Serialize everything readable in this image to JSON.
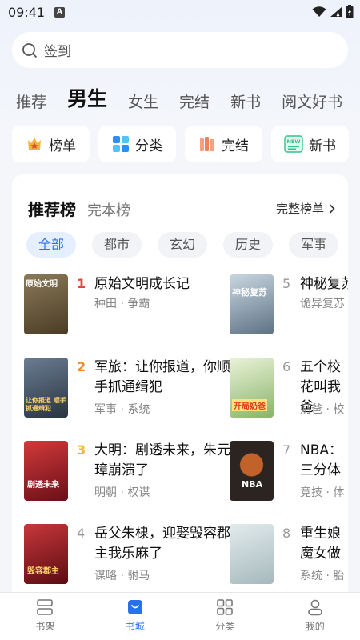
{
  "status_bar": {
    "time": "09:41",
    "badge": "A"
  },
  "search": {
    "placeholder": "签到"
  },
  "channels": [
    {
      "label": "推荐",
      "active": false
    },
    {
      "label": "男生",
      "active": true
    },
    {
      "label": "女生",
      "active": false
    },
    {
      "label": "完结",
      "active": false
    },
    {
      "label": "新书",
      "active": false
    },
    {
      "label": "阅文好书",
      "active": false
    }
  ],
  "quick_links": [
    {
      "label": "榜单",
      "icon": "crown-icon"
    },
    {
      "label": "分类",
      "icon": "grid-icon"
    },
    {
      "label": "完结",
      "icon": "books-icon"
    },
    {
      "label": "新书",
      "icon": "new-icon",
      "icon_text": "NEW"
    }
  ],
  "ranking": {
    "tabs": [
      {
        "label": "推荐榜",
        "active": true
      },
      {
        "label": "完本榜",
        "active": false
      }
    ],
    "full_list_link": "完整榜单",
    "filters": [
      {
        "label": "全部",
        "active": true
      },
      {
        "label": "都市",
        "active": false
      },
      {
        "label": "玄幻",
        "active": false
      },
      {
        "label": "历史",
        "active": false
      },
      {
        "label": "军事",
        "active": false
      }
    ],
    "books": [
      {
        "rank": "1",
        "title": "原始文明成长记",
        "meta": "种田 · 争霸",
        "cover_text": "原始文明",
        "cover_color": "#6b5a3c"
      },
      {
        "rank": "2",
        "title": "军旅：让你报道，你顺手抓通缉犯",
        "meta": "军事 · 系统",
        "cover_text": "让你报道 顺手抓通缉犯",
        "cover_color": "#3a4a5e"
      },
      {
        "rank": "3",
        "title": "大明：剧透未来，朱元璋崩溃了",
        "meta": "明朝 · 权谋",
        "cover_text": "剧透未来",
        "cover_color": "#a3202a"
      },
      {
        "rank": "4",
        "title": "岳父朱棣，迎娶毁容郡主我乐麻了",
        "meta": "谋略 · 驸马",
        "cover_text": "毁容郡主",
        "cover_color": "#8a1c22"
      },
      {
        "rank": "5",
        "title": "神秘复苏",
        "meta": "诡异复苏",
        "cover_text": "神秘复苏",
        "cover_color": "#7f93a6"
      },
      {
        "rank": "6",
        "title": "五个校花叫我爸",
        "meta": "奶爸 · 校",
        "cover_text": "开局奶爸",
        "cover_color": "#a7c98a"
      },
      {
        "rank": "7",
        "title": "NBA：三分体",
        "meta": "竞技 · 体",
        "cover_text": "NBA",
        "cover_color": "#2e2824"
      },
      {
        "rank": "8",
        "title": "重生娘魔女做",
        "meta": "系统 · 胎",
        "cover_text": "",
        "cover_color": "#c8d4d6"
      }
    ]
  },
  "bottom_nav": [
    {
      "label": "书架",
      "icon": "bookshelf-icon",
      "active": false
    },
    {
      "label": "书城",
      "icon": "bookstore-bag-icon",
      "active": true
    },
    {
      "label": "分类",
      "icon": "category-grid-icon",
      "active": false
    },
    {
      "label": "我的",
      "icon": "profile-icon",
      "active": false
    }
  ]
}
